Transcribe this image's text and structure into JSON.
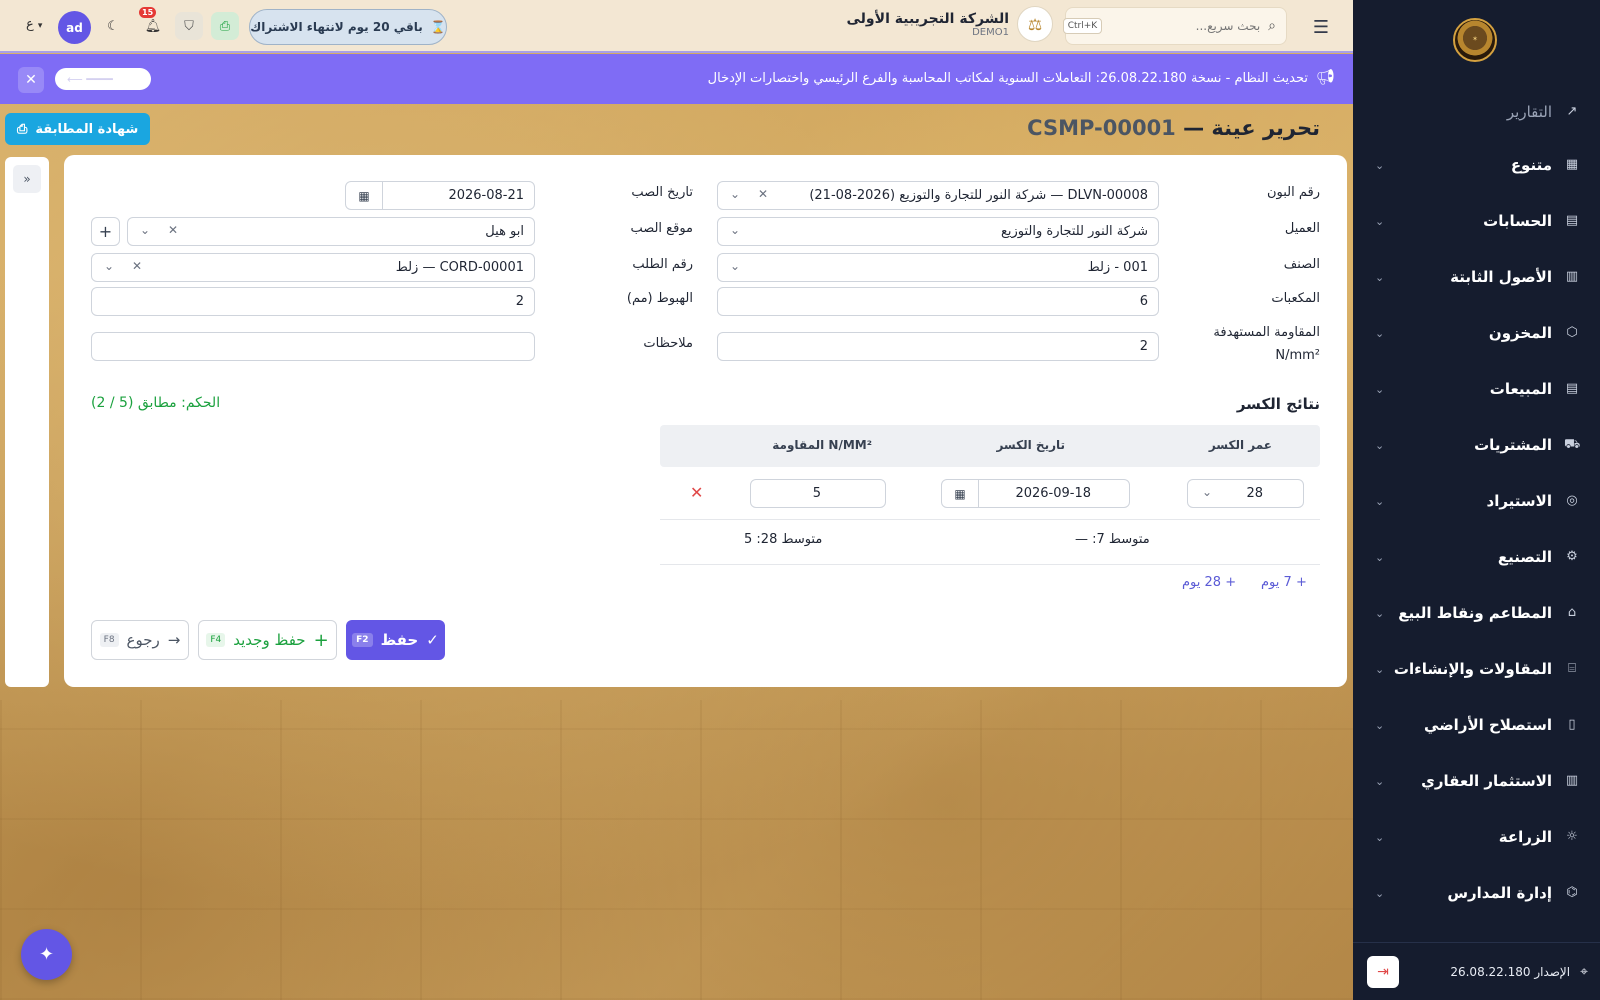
{
  "topbar": {
    "search_placeholder": "بحث سريع...",
    "search_shortcut": "Ctrl+K",
    "company_name": "الشركة التجريبية الأولى",
    "company_code": "DEMO1",
    "subscription": "باقي 20 يوم لانتهاء الاشتراك",
    "notifications_count": "15",
    "avatar": "ad",
    "language": "ع"
  },
  "announcement": {
    "text": "تحديث النظام - نسخة 26.08.22.180: التعاملات السنوية لمكاتب المحاسبة والفرع الرئيسي واختصارات الإدخال"
  },
  "page": {
    "title": "تحرير عينة —",
    "code": "CSMP-00001",
    "certificate_button": "شهادة المطابقة"
  },
  "form": {
    "voucher_label": "رقم البون",
    "voucher_value": "DLVN-00008 — شركة النور للتجارة والتوزيع (2026-08-21)",
    "pour_date_label": "تاريخ الصب",
    "pour_date_value": "2026-08-21",
    "customer_label": "العميل",
    "customer_value": "شركة النور للتجارة والتوزيع",
    "pour_site_label": "موقع الصب",
    "pour_site_value": "ابو هيل",
    "item_label": "الصنف",
    "item_value": "001 - زلط",
    "order_label": "رقم الطلب",
    "order_value": "CORD-00001 — زلط",
    "cubes_label": "المكعبات",
    "cubes_value": "6",
    "slump_label": "الهبوط (مم)",
    "slump_value": "2",
    "target_strength_label": "المقاومة المستهدفة",
    "target_strength_unit": "N/mm²",
    "target_strength_value": "2",
    "notes_label": "ملاحظات",
    "notes_value": ""
  },
  "results": {
    "title": "نتائج الكسر",
    "verdict": "الحكم: مطابق (5 / 2)",
    "columns": [
      "عمر الكسر",
      "تاريخ الكسر",
      "المقاومة N/MM²"
    ],
    "rows": [
      {
        "age": "28",
        "date": "2026-09-18",
        "strength": "5"
      }
    ],
    "avg7": "متوسط 7: —",
    "avg28": "متوسط 28: 5",
    "add7": "7 يوم",
    "add28": "28 يوم"
  },
  "actions": {
    "save": "حفظ",
    "save_key": "F2",
    "save_new": "حفظ وجديد",
    "save_new_key": "F4",
    "back": "رجوع",
    "back_key": "F8"
  },
  "sidebar": {
    "reports": "التقارير",
    "items": [
      {
        "label": "متنوع",
        "icon": "grid-icon"
      },
      {
        "label": "الحسابات",
        "icon": "calculator-icon"
      },
      {
        "label": "الأصول الثابتة",
        "icon": "building-icon"
      },
      {
        "label": "المخزون",
        "icon": "box-icon"
      },
      {
        "label": "المبيعات",
        "icon": "receipt-icon"
      },
      {
        "label": "المشتريات",
        "icon": "truck-icon"
      },
      {
        "label": "الاستيراد",
        "icon": "globe-icon"
      },
      {
        "label": "التصنيع",
        "icon": "cog-icon"
      },
      {
        "label": "المطاعم ونقاط البيع",
        "icon": "store-icon"
      },
      {
        "label": "المقاولات والإنشاءات",
        "icon": "bank-icon"
      },
      {
        "label": "استصلاح الأراضي",
        "icon": "map-icon"
      },
      {
        "label": "الاستثمار العقاري",
        "icon": "building2-icon"
      },
      {
        "label": "الزراعة",
        "icon": "sun-icon"
      },
      {
        "label": "إدارة المدارس",
        "icon": "graduation-icon"
      }
    ],
    "version": "الإصدار 26.08.22.180"
  },
  "colors": {
    "sidebar": "#151c2e",
    "accent": "#6356e5",
    "announcement": "#7f6cf5",
    "success": "#1ba13e",
    "cert": "#1aa6e0"
  }
}
